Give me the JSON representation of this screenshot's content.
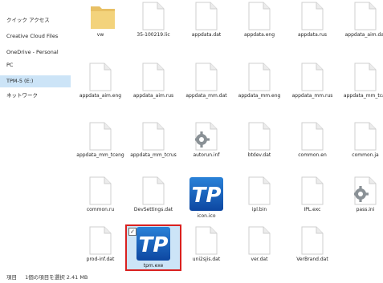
{
  "nav": {
    "items": [
      {
        "label": "クイック アクセス"
      },
      {
        "label": "Creative Cloud Files"
      },
      {
        "label": "OneDrive - Personal"
      },
      {
        "label": "PC"
      },
      {
        "label": "TPM-5 (E:)"
      },
      {
        "label": "ネットワーク"
      }
    ],
    "selected": "TPM-5 (E:)"
  },
  "files": [
    {
      "name": "vw",
      "icon": "folder-icon"
    },
    {
      "name": "35-100219.lic",
      "icon": "document-icon"
    },
    {
      "name": "appdata.dat",
      "icon": "document-icon"
    },
    {
      "name": "appdata.eng",
      "icon": "document-icon"
    },
    {
      "name": "appdata.rus",
      "icon": "document-icon"
    },
    {
      "name": "appdata_aim.dat",
      "icon": "document-icon"
    },
    {
      "name": "appdata_aim.eng",
      "icon": "document-icon"
    },
    {
      "name": "appdata_aim.rus",
      "icon": "document-icon"
    },
    {
      "name": "appdata_mm.dat",
      "icon": "document-icon"
    },
    {
      "name": "appdata_mm.eng",
      "icon": "document-icon"
    },
    {
      "name": "appdata_mm.rus",
      "icon": "document-icon"
    },
    {
      "name": "appdata_mm_tcat",
      "icon": "document-icon"
    },
    {
      "name": "appdata_mm_tceng",
      "icon": "document-icon"
    },
    {
      "name": "appdata_mm_tcrus",
      "icon": "document-icon"
    },
    {
      "name": "autorun.inf",
      "icon": "settings-file-icon"
    },
    {
      "name": "btdev.dat",
      "icon": "document-icon"
    },
    {
      "name": "common.en",
      "icon": "document-icon"
    },
    {
      "name": "common.ja",
      "icon": "document-icon"
    },
    {
      "name": "common.ru",
      "icon": "document-icon"
    },
    {
      "name": "DevSettings.dat",
      "icon": "document-icon"
    },
    {
      "name": "icon.ico",
      "icon": "tp-logo-icon"
    },
    {
      "name": "ipl.bin",
      "icon": "document-icon"
    },
    {
      "name": "IPL.exc",
      "icon": "document-icon"
    },
    {
      "name": "pass.ini",
      "icon": "settings-file-icon"
    },
    {
      "name": "prod-inf.dat",
      "icon": "document-icon"
    },
    {
      "name": "tpm.exe",
      "icon": "tp-logo-icon",
      "selected": true
    },
    {
      "name": "uni2sjis.dat",
      "icon": "document-icon"
    },
    {
      "name": "ver.dat",
      "icon": "document-icon"
    },
    {
      "name": "VerBrand.dat",
      "icon": "document-icon"
    }
  ],
  "status": {
    "items": "項目",
    "selected": "1個の項目を選択 2.41 MB"
  },
  "colors": {
    "selection": "#cce4f7",
    "highlight_border": "#d9201f",
    "tp_blue": "#1565c0"
  }
}
